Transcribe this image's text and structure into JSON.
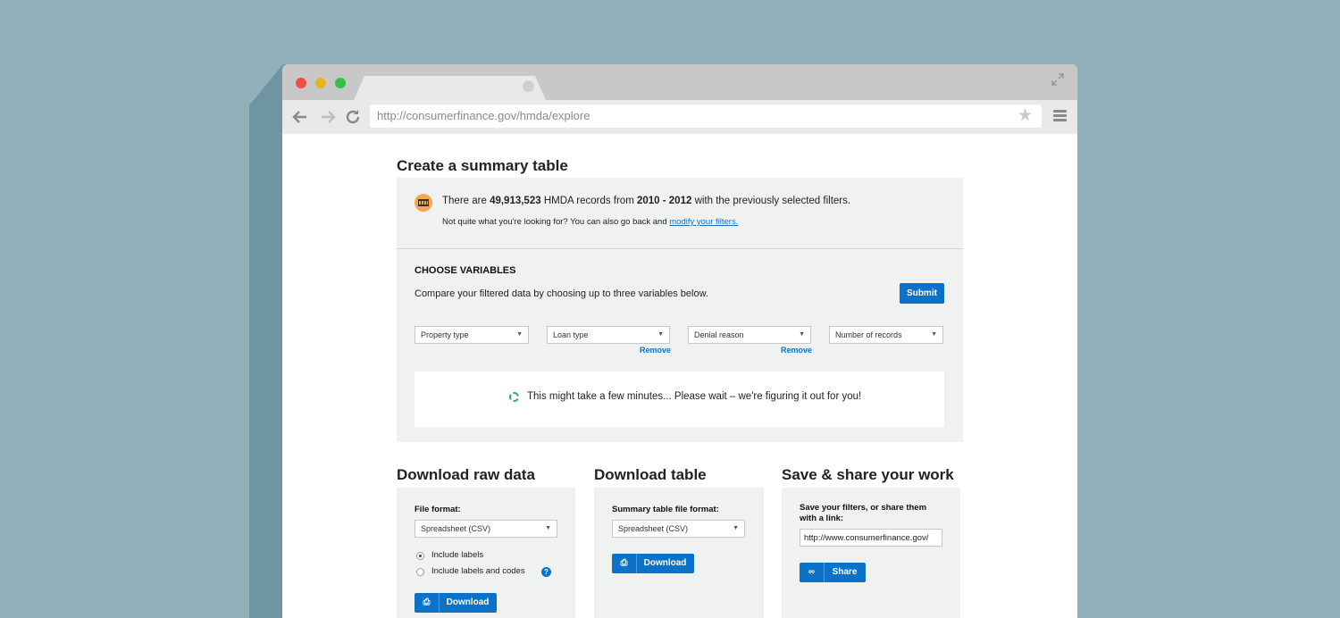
{
  "browser": {
    "url": "http://consumerfinance.gov/hmda/explore",
    "icons": [
      "back-icon",
      "forward-icon",
      "reload-icon",
      "star-icon",
      "menu-icon",
      "expand-icon"
    ]
  },
  "summary": {
    "title": "Create a summary table",
    "info_prefix": "There are ",
    "record_count": "49,913,523",
    "info_mid": " HMDA records from ",
    "year_range": "2010 - 2012",
    "info_suffix": " with the previously selected filters.",
    "note_prefix": "Not quite what you're looking for? You can also go back and ",
    "note_link": "modify your filters."
  },
  "variables": {
    "title": "CHOOSE VARIABLES",
    "description": "Compare your filtered data by choosing up to three variables below.",
    "submit_label": "Submit",
    "selects": [
      "Property type",
      "Loan type",
      "Denial reason",
      "Number of records"
    ],
    "remove_label": "Remove",
    "wait_message": "This might take a few minutes... Please wait – we're figuring it out for you!"
  },
  "raw_data": {
    "title": "Download raw data",
    "format_label": "File format:",
    "format_value": "Spreadsheet (CSV)",
    "option_labels": "Include labels",
    "option_labels_codes": "Include labels and codes",
    "help": "?",
    "download_label": "Download"
  },
  "table_download": {
    "title": "Download table",
    "format_label": "Summary table file format:",
    "format_value": "Spreadsheet (CSV)",
    "download_label": "Download"
  },
  "share": {
    "title": "Save & share your work",
    "description_line1": "Save your filters, or share them",
    "description_line2": "with a link:",
    "link_value": "http://www.consumerfinance.gov/",
    "share_label": "Share"
  },
  "colors": {
    "background": "#91b0ba",
    "accent": "#0a73c9",
    "panel": "#f0f1f1"
  }
}
